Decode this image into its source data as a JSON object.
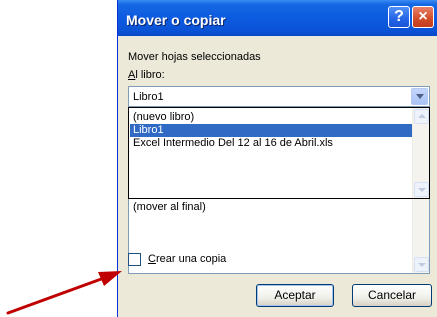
{
  "dialog": {
    "title": "Mover o copiar",
    "help_label": "?",
    "close_label": "×",
    "move_selected_label": "Mover hojas seleccionadas",
    "to_book_label_first": "A",
    "to_book_label_rest": "l libro:",
    "book_combo_value": "Libro1",
    "book_options": [
      "(nuevo libro)",
      "Libro1",
      "Excel Intermedio Del 12 al 16 de Abril.xls"
    ],
    "selected_book_index": 1,
    "before_sheet_visible_item": "(mover al final)",
    "copy_checkbox_first": "C",
    "copy_checkbox_rest": "rear una copia",
    "copy_checked": false,
    "accept_label": "Aceptar",
    "cancel_label": "Cancelar"
  },
  "colors": {
    "title_bar": "#0a52d6",
    "dialog_bg": "#ece9d8",
    "selection": "#316ac5",
    "annotation_arrow": "#c00000"
  }
}
